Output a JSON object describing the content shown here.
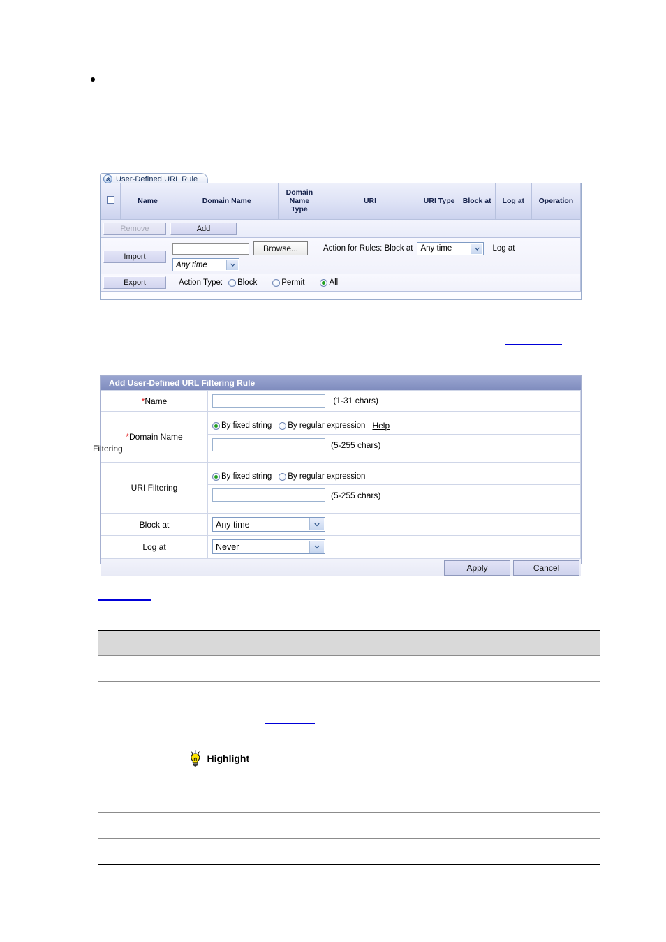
{
  "document": {
    "bullet_text": "",
    "links": [
      {
        "name": "figure-link-top",
        "text": ""
      },
      {
        "name": "figure-link-bottom",
        "text": ""
      },
      {
        "name": "inline-reference-link",
        "text": ""
      }
    ]
  },
  "url_rule_panel": {
    "tab_label": "User-Defined URL Rule",
    "collapse_icon": "chevron-double-up-icon",
    "table_headers": [
      "",
      "Name",
      "Domain Name",
      "Domain Name Type",
      "URI",
      "URI Type",
      "Block at",
      "Log at",
      "Operation"
    ],
    "select_all_checkbox": "unchecked",
    "buttons": {
      "remove": "Remove",
      "remove_state": "disabled",
      "add": "Add",
      "import": "Import",
      "export": "Export",
      "browse": "Browse..."
    },
    "import_row": {
      "file_value": "",
      "action_for_rules_label": "Action for Rules: Block at",
      "block_at_value": "Any time",
      "log_at_label": "Log at",
      "log_at_value": "Any time"
    },
    "action_type": {
      "label": "Action Type:",
      "options": [
        "Block",
        "Permit",
        "All"
      ],
      "selected": "All"
    }
  },
  "add_dialog": {
    "title": "Add User-Defined URL Filtering Rule",
    "rows": {
      "name": {
        "label": "Name",
        "required": true,
        "value": "",
        "hint": "(1-31   chars)"
      },
      "domain_name_filtering": {
        "label_line1": "Domain Name",
        "label_line2": "Filtering",
        "required": true,
        "radio_options": [
          "By fixed string",
          "By regular expression"
        ],
        "radio_selected": "By fixed string",
        "help_link": "Help",
        "value": "",
        "hint": "(5-255   chars)"
      },
      "uri_filtering": {
        "label": "URI Filtering",
        "required": false,
        "radio_options": [
          "By fixed string",
          "By regular expression"
        ],
        "radio_selected": "By fixed string",
        "value": "",
        "hint": "(5-255   chars)"
      },
      "block_at": {
        "label": "Block at",
        "value": "Any time"
      },
      "log_at": {
        "label": "Log at",
        "value": "Never"
      }
    },
    "footer": {
      "apply": "Apply",
      "cancel": "Cancel"
    }
  },
  "parameter_table": {
    "headers": [
      "",
      ""
    ],
    "rows": [
      {
        "col1": "",
        "col2": ""
      },
      {
        "col1": "",
        "col2": "",
        "has_highlight_note": true,
        "highlight_label": "Highlight",
        "highlight_icon": "lightbulb-icon",
        "inline_link": ""
      },
      {
        "col1": "",
        "col2": ""
      },
      {
        "col1": "",
        "col2": ""
      }
    ]
  },
  "colors": {
    "panel_border": "#9aaccc",
    "table_header_bg": "#dfe3f6",
    "dialog_title_bg": "#8d99c8",
    "link_blue": "#0000d8",
    "required_star": "#e01010",
    "radio_selected": "#1f9e1f",
    "doc_header_gray": "#d9d9d9",
    "bulb_yellow": "#ffe500"
  }
}
